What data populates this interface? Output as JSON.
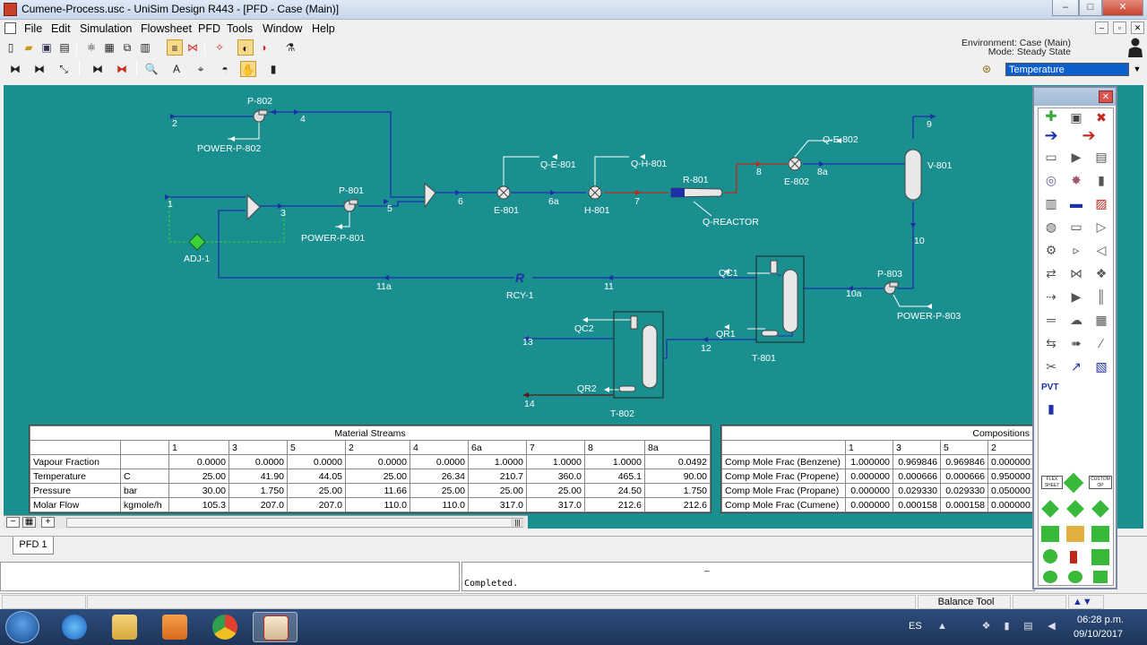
{
  "window": {
    "title": "Cumene-Process.usc - UniSim Design R443 - [PFD - Case (Main)]",
    "min": "–",
    "max": "□",
    "close": "✕"
  },
  "menu": [
    "File",
    "Edit",
    "Simulation",
    "Flowsheet",
    "PFD",
    "Tools",
    "Window",
    "Help"
  ],
  "environment": {
    "line1": "Environment: Case (Main)",
    "line2": "Mode: Steady State"
  },
  "variable_select": "Temperature",
  "pfd": {
    "labels": {
      "s2": "2",
      "s4": "4",
      "p802": "P-802",
      "power_p802": "POWER-P-802",
      "s1": "1",
      "s3": "3",
      "s5": "5",
      "s6": "6",
      "s6a": "6a",
      "s7": "7",
      "s8": "8",
      "s8a": "8a",
      "s9": "9",
      "s10": "10",
      "s10a": "10a",
      "s11": "11",
      "s11a": "11a",
      "s12": "12",
      "s13": "13",
      "s14": "14",
      "p801": "P-801",
      "power_p801": "POWER-P-801",
      "adj1": "ADJ-1",
      "e801": "E-801",
      "qe801": "Q-E-801",
      "h801": "H-801",
      "qh801": "Q-H-801",
      "r801": "R-801",
      "qreactor": "Q-REACTOR",
      "e802": "E-802",
      "qe802": "Q-E-802",
      "v801": "V-801",
      "p803": "P-803",
      "power_p803": "POWER-P-803",
      "rcy1": "RCY-1",
      "rcy_glyph": "R",
      "qc1": "QC1",
      "qr1": "QR1",
      "t801": "T-801",
      "qc2": "QC2",
      "qr2": "QR2",
      "t802": "T-802"
    }
  },
  "material_streams": {
    "title": "Material Streams",
    "columns": [
      "1",
      "3",
      "5",
      "2",
      "4",
      "6a",
      "7",
      "8",
      "8a"
    ],
    "rows": [
      {
        "name": "Vapour Fraction",
        "unit": "",
        "values": [
          "0.0000",
          "0.0000",
          "0.0000",
          "0.0000",
          "0.0000",
          "1.0000",
          "1.0000",
          "1.0000",
          "0.0492"
        ]
      },
      {
        "name": "Temperature",
        "unit": "C",
        "values": [
          "25.00",
          "41.90",
          "44.05",
          "25.00",
          "26.34",
          "210.7",
          "360.0",
          "465.1",
          "90.00"
        ]
      },
      {
        "name": "Pressure",
        "unit": "bar",
        "values": [
          "30.00",
          "1.750",
          "25.00",
          "11.66",
          "25.00",
          "25.00",
          "25.00",
          "24.50",
          "1.750"
        ]
      },
      {
        "name": "Molar Flow",
        "unit": "kgmole/h",
        "values": [
          "105.3",
          "207.0",
          "207.0",
          "110.0",
          "110.0",
          "317.0",
          "317.0",
          "212.6",
          "212.6"
        ]
      }
    ]
  },
  "compositions": {
    "title": "Compositions",
    "columns": [
      "1",
      "3",
      "5",
      "2"
    ],
    "rows": [
      {
        "name": "Comp Mole Frac (Benzene)",
        "values": [
          "1.000000",
          "0.969846",
          "0.969846",
          "0.000000"
        ]
      },
      {
        "name": "Comp Mole Frac (Propene)",
        "values": [
          "0.000000",
          "0.000666",
          "0.000666",
          "0.950000"
        ]
      },
      {
        "name": "Comp Mole Frac (Propane)",
        "values": [
          "0.000000",
          "0.029330",
          "0.029330",
          "0.050000"
        ]
      },
      {
        "name": "Comp Mole Frac (Cumene)",
        "values": [
          "0.000000",
          "0.000158",
          "0.000158",
          "0.000000"
        ]
      }
    ]
  },
  "bottom_bar": {
    "minus": "−",
    "grid": "▦",
    "plus": "+",
    "scroll_thumb": "|||"
  },
  "tab": "PFD 1",
  "message": "Completed.",
  "status": {
    "tool": "Balance Tool"
  },
  "palette": {
    "close": "✕",
    "pvt": "PVT",
    "flex_label": "FLEX SHEET",
    "custom_label": "CUSTOM OP",
    "icons": [
      "✚",
      "▣",
      "✖",
      "➔",
      "➔",
      "▭",
      "▶",
      "▤",
      "◎",
      "✸",
      "▮",
      "▥",
      "▬",
      "▨",
      "◍",
      "▭",
      "▷",
      "⚙",
      "▹",
      "◁",
      "⇄",
      "⋈",
      "❖",
      "⇢",
      "▶",
      "║",
      "═",
      "☁",
      "▦",
      "⇆",
      "➠",
      "∕",
      "✂",
      "↗",
      "▧",
      "▮"
    ]
  },
  "taskbar": {
    "lang": "ES",
    "time": "06:28 p.m.",
    "date": "09/10/2017"
  },
  "colors": {
    "pfd_background": "#1a8f8f",
    "material_stream": "#1f2fa8",
    "hot_stream": "#c0281c",
    "energy_stream": "#ffffff",
    "logic_stream": "#3ad13a",
    "variable_highlight": "#0a5fcc"
  }
}
